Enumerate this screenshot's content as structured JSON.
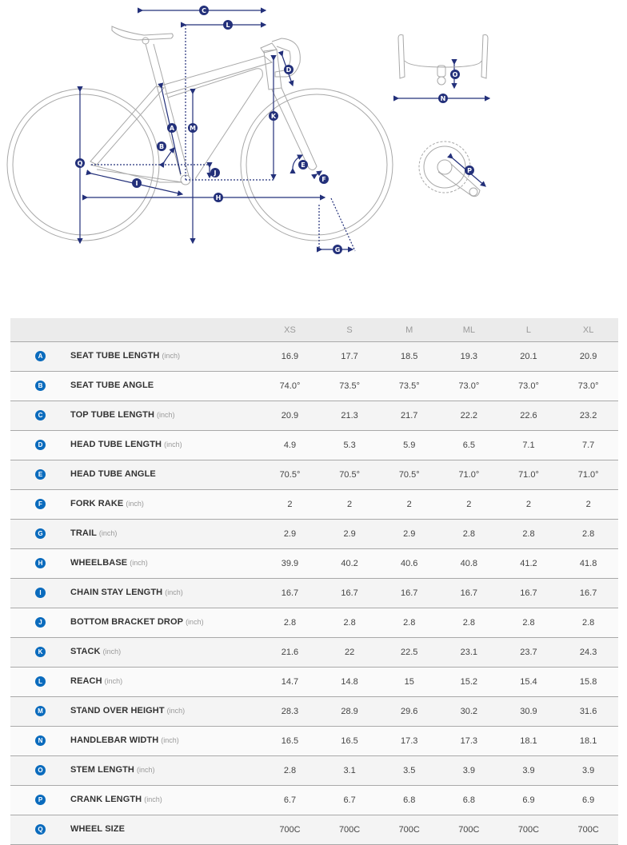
{
  "diagram": {
    "title": "Bike geometry diagram",
    "markers": [
      "A",
      "B",
      "C",
      "D",
      "E",
      "F",
      "G",
      "H",
      "I",
      "J",
      "K",
      "L",
      "M",
      "N",
      "O",
      "P",
      "Q"
    ],
    "colors": {
      "frame_line": "#9a9a9a",
      "dimension": "#23307a",
      "badge": "#0a6bbd"
    }
  },
  "table": {
    "sizes": [
      "XS",
      "S",
      "M",
      "ML",
      "L",
      "XL"
    ],
    "rows": [
      {
        "marker": "A",
        "label": "SEAT TUBE LENGTH",
        "unit": "(inch)",
        "values": [
          "16.9",
          "17.7",
          "18.5",
          "19.3",
          "20.1",
          "20.9"
        ]
      },
      {
        "marker": "B",
        "label": "SEAT TUBE ANGLE",
        "unit": "",
        "values": [
          "74.0°",
          "73.5°",
          "73.5°",
          "73.0°",
          "73.0°",
          "73.0°"
        ]
      },
      {
        "marker": "C",
        "label": "TOP TUBE LENGTH",
        "unit": "(inch)",
        "values": [
          "20.9",
          "21.3",
          "21.7",
          "22.2",
          "22.6",
          "23.2"
        ]
      },
      {
        "marker": "D",
        "label": "HEAD TUBE LENGTH",
        "unit": "(inch)",
        "values": [
          "4.9",
          "5.3",
          "5.9",
          "6.5",
          "7.1",
          "7.7"
        ]
      },
      {
        "marker": "E",
        "label": "HEAD TUBE ANGLE",
        "unit": "",
        "values": [
          "70.5°",
          "70.5°",
          "70.5°",
          "71.0°",
          "71.0°",
          "71.0°"
        ]
      },
      {
        "marker": "F",
        "label": "FORK RAKE",
        "unit": "(inch)",
        "values": [
          "2",
          "2",
          "2",
          "2",
          "2",
          "2"
        ]
      },
      {
        "marker": "G",
        "label": "TRAIL",
        "unit": "(inch)",
        "values": [
          "2.9",
          "2.9",
          "2.9",
          "2.8",
          "2.8",
          "2.8"
        ]
      },
      {
        "marker": "H",
        "label": "WHEELBASE",
        "unit": "(inch)",
        "values": [
          "39.9",
          "40.2",
          "40.6",
          "40.8",
          "41.2",
          "41.8"
        ]
      },
      {
        "marker": "I",
        "label": "CHAIN STAY LENGTH",
        "unit": "(inch)",
        "values": [
          "16.7",
          "16.7",
          "16.7",
          "16.7",
          "16.7",
          "16.7"
        ]
      },
      {
        "marker": "J",
        "label": "BOTTOM BRACKET DROP",
        "unit": "(inch)",
        "values": [
          "2.8",
          "2.8",
          "2.8",
          "2.8",
          "2.8",
          "2.8"
        ]
      },
      {
        "marker": "K",
        "label": "STACK",
        "unit": "(inch)",
        "values": [
          "21.6",
          "22",
          "22.5",
          "23.1",
          "23.7",
          "24.3"
        ]
      },
      {
        "marker": "L",
        "label": "REACH",
        "unit": "(inch)",
        "values": [
          "14.7",
          "14.8",
          "15",
          "15.2",
          "15.4",
          "15.8"
        ]
      },
      {
        "marker": "M",
        "label": "STAND OVER HEIGHT",
        "unit": "(inch)",
        "values": [
          "28.3",
          "28.9",
          "29.6",
          "30.2",
          "30.9",
          "31.6"
        ]
      },
      {
        "marker": "N",
        "label": "HANDLEBAR WIDTH",
        "unit": "(inch)",
        "values": [
          "16.5",
          "16.5",
          "17.3",
          "17.3",
          "18.1",
          "18.1"
        ]
      },
      {
        "marker": "O",
        "label": "STEM LENGTH",
        "unit": "(inch)",
        "values": [
          "2.8",
          "3.1",
          "3.5",
          "3.9",
          "3.9",
          "3.9"
        ]
      },
      {
        "marker": "P",
        "label": "CRANK LENGTH",
        "unit": "(inch)",
        "values": [
          "6.7",
          "6.7",
          "6.8",
          "6.8",
          "6.9",
          "6.9"
        ]
      },
      {
        "marker": "Q",
        "label": "WHEEL SIZE",
        "unit": "",
        "values": [
          "700C",
          "700C",
          "700C",
          "700C",
          "700C",
          "700C"
        ]
      }
    ]
  }
}
